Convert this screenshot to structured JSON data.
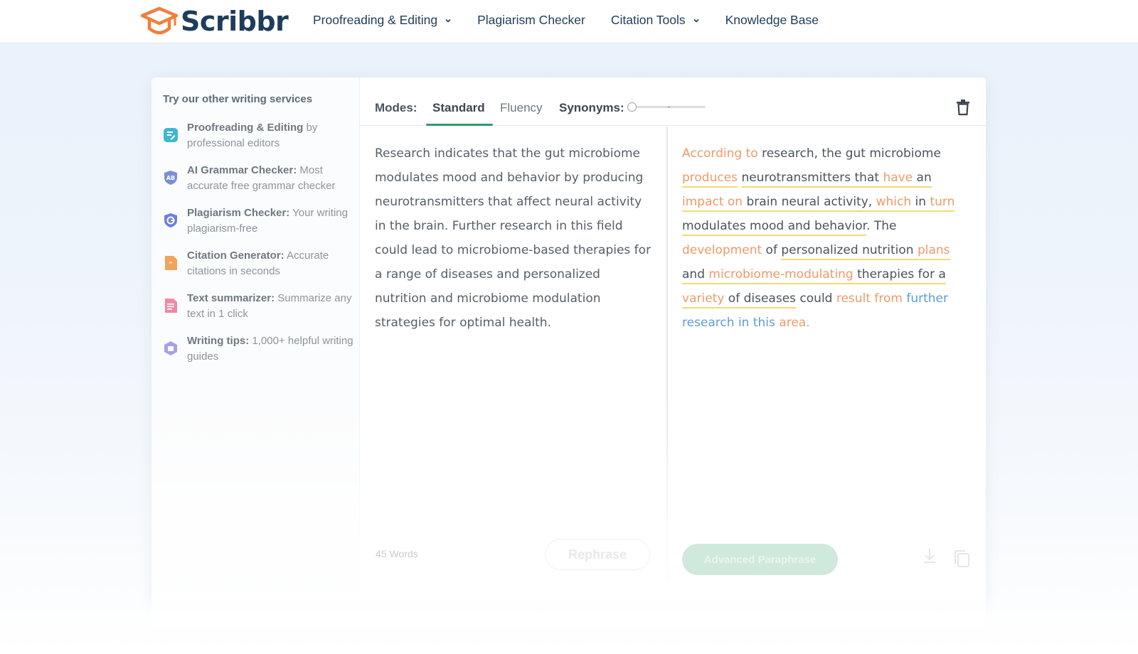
{
  "header": {
    "brand": "Scribbr",
    "nav": [
      {
        "label": "Proofreading & Editing",
        "has_dropdown": true
      },
      {
        "label": "Plagiarism Checker",
        "has_dropdown": false
      },
      {
        "label": "Citation Tools",
        "has_dropdown": true
      },
      {
        "label": "Knowledge Base",
        "has_dropdown": false
      }
    ]
  },
  "sidebar": {
    "title": "Try our other writing services",
    "items": [
      {
        "name": "Proofreading & Editing",
        "desc": " by professional editors",
        "icon": "document-pen-icon",
        "color": "#3db6d8"
      },
      {
        "name": "AI Grammar Checker:",
        "desc": " Most accurate free grammar checker",
        "icon": "grammar-shield-icon",
        "color": "#7a8fd6"
      },
      {
        "name": "Plagiarism Checker:",
        "desc": " Your writing plagiarism-free",
        "icon": "plagiarism-shield-icon",
        "color": "#6a7fe0"
      },
      {
        "name": "Citation Generator:",
        "desc": " Accurate citations in seconds",
        "icon": "citation-quote-icon",
        "color": "#f3a35a"
      },
      {
        "name": "Text summarizer:",
        "desc": " Summarize any text in 1 click",
        "icon": "summarizer-list-icon",
        "color": "#ee8aa6"
      },
      {
        "name": "Writing tips:",
        "desc": " 1,000+ helpful writing guides",
        "icon": "writing-tips-icon",
        "color": "#a89df0"
      }
    ]
  },
  "toolbar": {
    "modes_label": "Modes:",
    "modes": [
      "Standard",
      "Fluency"
    ],
    "active_mode": "Standard",
    "synonyms_label": "Synonyms:",
    "synonyms_level": 0.0
  },
  "input": {
    "text": "Research indicates that the gut microbiome modulates mood and behavior by producing neurotransmitters that affect neural activity in the brain. Further research in this field could lead to microbiome-based therapies for a range of diseases and personalized nutrition and microbiome modulation strategies for optimal health.",
    "word_count": "45 Words",
    "rephrase_label": "Rephrase"
  },
  "output": {
    "segments": [
      {
        "t": "According to",
        "c": "o"
      },
      {
        "t": " research, the gut microbiome ",
        "c": ""
      },
      {
        "t": "produces",
        "c": "o u"
      },
      {
        "t": " ",
        "c": ""
      },
      {
        "t": "neurotransmitters that ",
        "c": "u"
      },
      {
        "t": "have",
        "c": "o u"
      },
      {
        "t": " an ",
        "c": "u"
      },
      {
        "t": "impact on",
        "c": "o u"
      },
      {
        "t": " brain neural activity, ",
        "c": "u"
      },
      {
        "t": "which",
        "c": "o u"
      },
      {
        "t": " in ",
        "c": "u"
      },
      {
        "t": "turn",
        "c": "o u"
      },
      {
        "t": " modulates mood and behavior",
        "c": "u"
      },
      {
        "t": ". The ",
        "c": ""
      },
      {
        "t": "development",
        "c": "o"
      },
      {
        "t": " of ",
        "c": ""
      },
      {
        "t": "personalized nutrition ",
        "c": "u"
      },
      {
        "t": "plans",
        "c": "o u"
      },
      {
        "t": " and ",
        "c": "u"
      },
      {
        "t": "microbiome-modulating",
        "c": "o u"
      },
      {
        "t": " therapies for a ",
        "c": "u"
      },
      {
        "t": "variety",
        "c": "o u"
      },
      {
        "t": " of diseases",
        "c": "u"
      },
      {
        "t": " could ",
        "c": ""
      },
      {
        "t": "result from",
        "c": "o"
      },
      {
        "t": " ",
        "c": ""
      },
      {
        "t": "further research in this",
        "c": "b"
      },
      {
        "t": " ",
        "c": ""
      },
      {
        "t": "area.",
        "c": "o"
      }
    ],
    "advanced_label": "Advanced Paraphrase"
  },
  "colors": {
    "brand_orange": "#f07f3c",
    "brand_navy": "#1f3c5a",
    "accent_green": "#2e9a6e",
    "changed_word": "#ee9a68",
    "structure_change": "#5e9bd6",
    "underline": "#f3da72"
  }
}
